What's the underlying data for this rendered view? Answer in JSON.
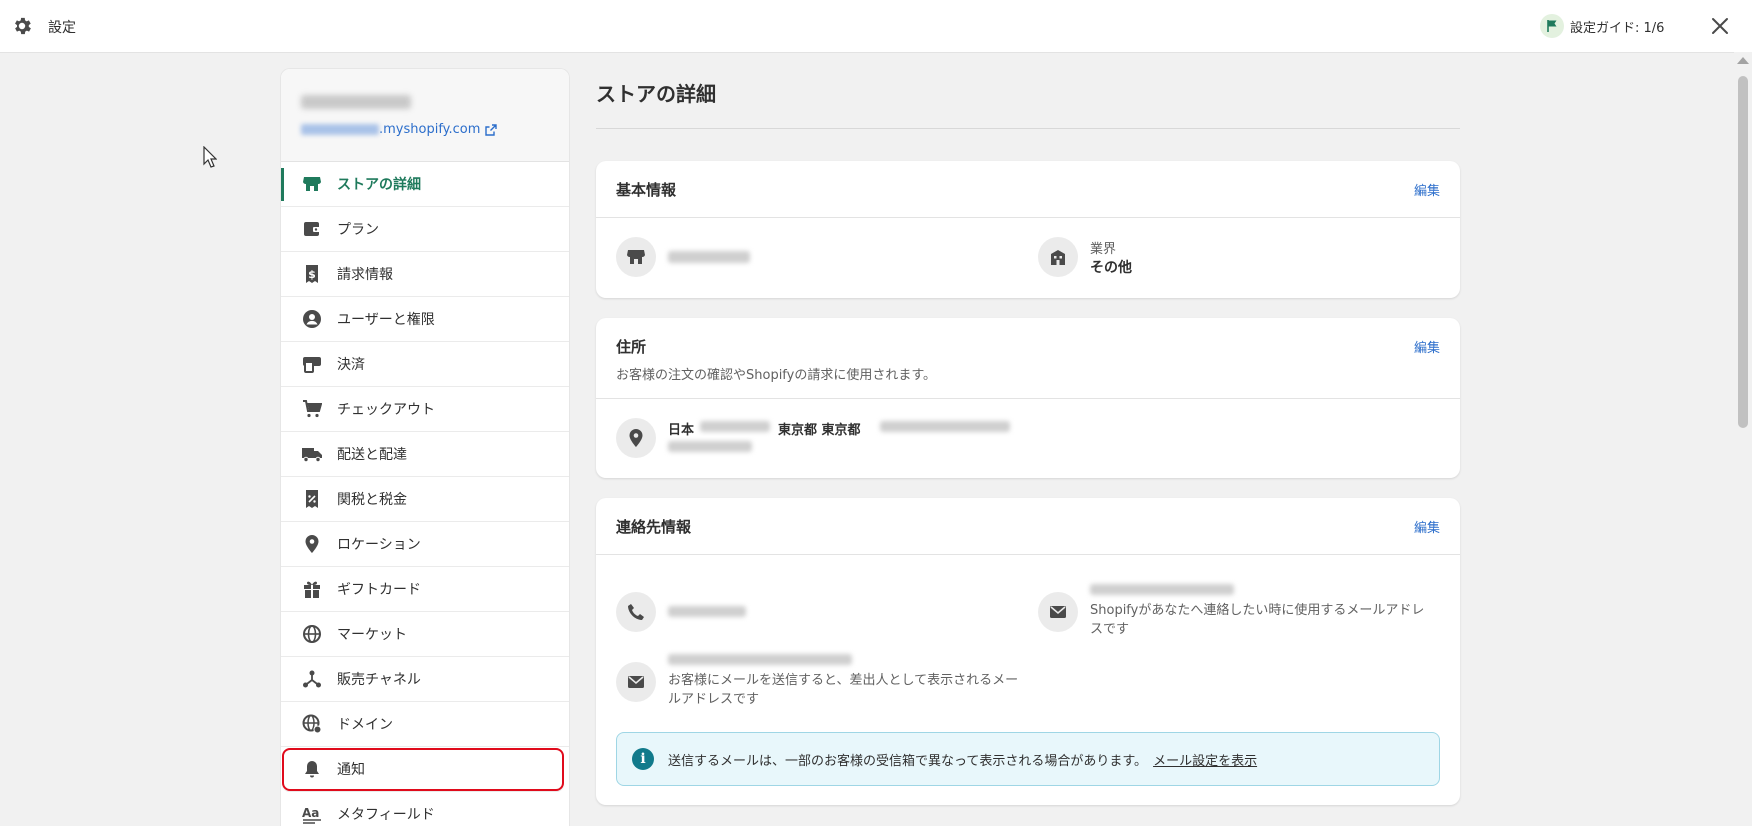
{
  "topbar": {
    "title": "設定",
    "guide_label": "設定ガイド: 1/6"
  },
  "store": {
    "url_suffix": ".myshopify.com"
  },
  "sidebar": {
    "items": [
      {
        "label": "ストアの詳細",
        "icon": "store-icon"
      },
      {
        "label": "プラン",
        "icon": "wallet-icon"
      },
      {
        "label": "請求情報",
        "icon": "bill-icon"
      },
      {
        "label": "ユーザーと権限",
        "icon": "user-icon"
      },
      {
        "label": "決済",
        "icon": "payment-icon"
      },
      {
        "label": "チェックアウト",
        "icon": "cart-icon"
      },
      {
        "label": "配送と配達",
        "icon": "truck-icon"
      },
      {
        "label": "関税と税金",
        "icon": "tax-icon"
      },
      {
        "label": "ロケーション",
        "icon": "location-icon"
      },
      {
        "label": "ギフトカード",
        "icon": "gift-icon"
      },
      {
        "label": "マーケット",
        "icon": "globe-icon"
      },
      {
        "label": "販売チャネル",
        "icon": "channels-icon"
      },
      {
        "label": "ドメイン",
        "icon": "domain-icon"
      },
      {
        "label": "通知",
        "icon": "bell-icon"
      },
      {
        "label": "メタフィールド",
        "icon": "metafield-icon"
      }
    ]
  },
  "main": {
    "page_title": "ストアの詳細",
    "basic": {
      "title": "基本情報",
      "edit": "編集",
      "industry_label": "業界",
      "industry_value": "その他"
    },
    "address": {
      "title": "住所",
      "edit": "編集",
      "subtitle": "お客様の注文の確認やShopifyの請求に使用されます。",
      "country": "日本",
      "prefecture": "東京都 東京都"
    },
    "contact": {
      "title": "連絡先情報",
      "edit": "編集",
      "store_email_desc": "Shopifyがあなたへ連絡したい時に使用するメールアドレスです",
      "sender_email_desc": "お客様にメールを送信すると、差出人として表示されるメールアドレスです",
      "banner_text": "送信するメールは、一部のお客様の受信箱で異なって表示される場合があります。",
      "banner_link": "メール設定を表示"
    }
  },
  "colors": {
    "accent_green": "#1f7a5c",
    "link_blue": "#2c6ecb",
    "highlight_red": "#e00b1c"
  }
}
